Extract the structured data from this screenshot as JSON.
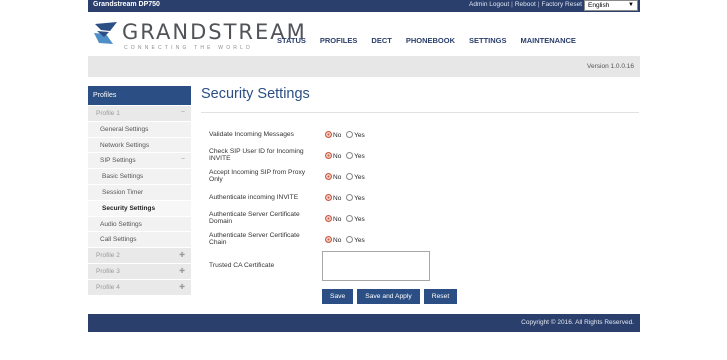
{
  "topbar": {
    "model": "Grandstream DP750",
    "links": [
      "Admin Logout",
      "Reboot",
      "Factory Reset"
    ],
    "language": "English"
  },
  "brand": {
    "name": "GRANDSTREAM",
    "tagline": "CONNECTING THE WORLD"
  },
  "nav": [
    "STATUS",
    "PROFILES",
    "DECT",
    "PHONEBOOK",
    "SETTINGS",
    "MAINTENANCE"
  ],
  "version": "Version 1.0.0.16",
  "sidebar": {
    "title": "Profiles",
    "items": [
      {
        "label": "Profile 1",
        "ctl": "−"
      },
      {
        "label": "General Settings"
      },
      {
        "label": "Network Settings"
      },
      {
        "label": "SIP Settings",
        "ctl": "−"
      },
      {
        "label": "Basic Settings"
      },
      {
        "label": "Session Timer"
      },
      {
        "label": "Security Settings"
      },
      {
        "label": "Audio Settings"
      },
      {
        "label": "Call Settings"
      },
      {
        "label": "Profile 2",
        "ctl": "✚"
      },
      {
        "label": "Profile 3",
        "ctl": "✚"
      },
      {
        "label": "Profile 4",
        "ctl": "✚"
      }
    ]
  },
  "page": {
    "title": "Security Settings",
    "options": {
      "no": "No",
      "yes": "Yes"
    },
    "fields": [
      {
        "label": "Validate Incoming Messages",
        "value": "No"
      },
      {
        "label": "Check SIP User ID for Incoming INVITE",
        "value": "No"
      },
      {
        "label": "Accept Incoming SIP from Proxy Only",
        "value": "No"
      },
      {
        "label": "Authenticate incoming INVITE",
        "value": "No"
      },
      {
        "label": "Authenticate Server Certificate Domain",
        "value": "No"
      },
      {
        "label": "Authenticate Server Certificate Chain",
        "value": "No"
      }
    ],
    "trusted_ca_label": "Trusted CA Certificate",
    "trusted_ca_value": "",
    "buttons": {
      "save": "Save",
      "save_apply": "Save and Apply",
      "reset": "Reset"
    }
  },
  "footer": {
    "copyright": "Copyright © 2016. All Rights Reserved."
  },
  "colors": {
    "nav_blue": "#2b3f6c",
    "accent_blue": "#2b4f84",
    "radio_selected": "#c8583f"
  }
}
